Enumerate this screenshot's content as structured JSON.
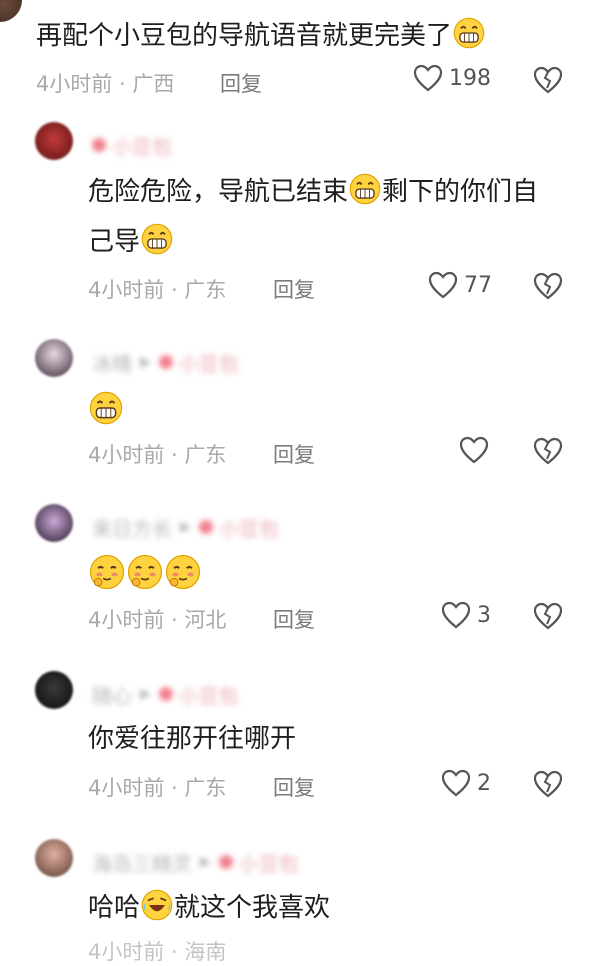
{
  "top_comment": {
    "text": "再配个小豆包的导航语音就更完美了",
    "time": "4小时前",
    "location": "广西",
    "reply_label": "回复",
    "likes": "198"
  },
  "replies": [
    {
      "text_line1": "危险危险，导航已结束",
      "text_line1b": "剩下的你们自",
      "text_line2": "己导",
      "time": "4小时前",
      "location": "广东",
      "reply_label": "回复",
      "likes": "77"
    },
    {
      "time": "4小时前",
      "location": "广东",
      "reply_label": "回复",
      "likes": ""
    },
    {
      "time": "4小时前",
      "location": "河北",
      "reply_label": "回复",
      "likes": "3"
    },
    {
      "text": "你爱往那开往哪开",
      "time": "4小时前",
      "location": "广东",
      "reply_label": "回复",
      "likes": "2"
    },
    {
      "text_a": "哈哈",
      "text_b": "就这个我喜欢"
    }
  ],
  "colors": {
    "text": "#1e1e1e",
    "meta": "#a9a9a9",
    "reply": "#7b7b7b",
    "blurred_tag": "#f17f8d"
  }
}
